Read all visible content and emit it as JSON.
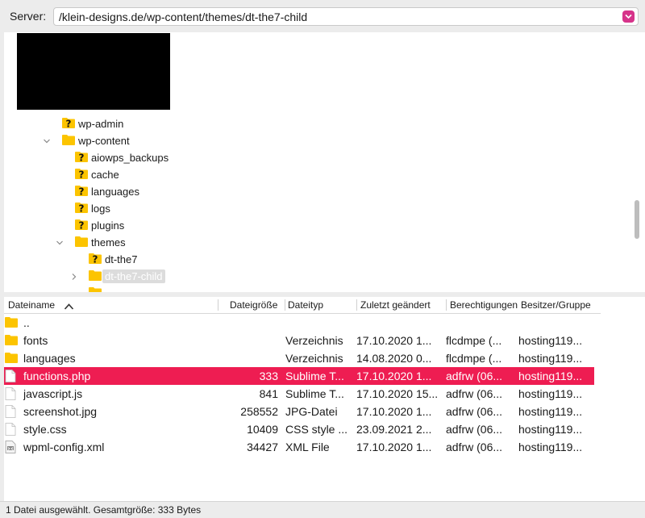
{
  "server": {
    "label": "Server:",
    "path": "/klein-designs.de/wp-content/themes/dt-the7-child"
  },
  "tree": {
    "nodes": [
      {
        "label": "wp-admin",
        "icon": "question-folder-icon",
        "expanded": false
      },
      {
        "label": "wp-content",
        "icon": "folder-icon",
        "expanded": true
      },
      {
        "label": "aiowps_backups",
        "icon": "question-folder-icon",
        "expanded": false
      },
      {
        "label": "cache",
        "icon": "question-folder-icon",
        "expanded": false
      },
      {
        "label": "languages",
        "icon": "question-folder-icon",
        "expanded": false
      },
      {
        "label": "logs",
        "icon": "question-folder-icon",
        "expanded": false
      },
      {
        "label": "plugins",
        "icon": "question-folder-icon",
        "expanded": false
      },
      {
        "label": "themes",
        "icon": "folder-icon",
        "expanded": true
      },
      {
        "label": "dt-the7",
        "icon": "question-folder-icon",
        "expanded": false
      },
      {
        "label": "dt-the7-child",
        "icon": "folder-icon",
        "expanded": false,
        "selected": true
      }
    ]
  },
  "list": {
    "columns": {
      "name": "Dateiname",
      "size": "Dateigröße",
      "type": "Dateityp",
      "modified": "Zuletzt geändert",
      "perms": "Berechtigungen",
      "owner": "Besitzer/Gruppe"
    },
    "rows": [
      {
        "name": "..",
        "size": "",
        "type": "",
        "modified": "",
        "perms": "",
        "owner": "",
        "icon": "folder-icon"
      },
      {
        "name": "fonts",
        "size": "",
        "type": "Verzeichnis",
        "modified": "17.10.2020 1...",
        "perms": "flcdmpe (...",
        "owner": "hosting119...",
        "icon": "folder-icon"
      },
      {
        "name": "languages",
        "size": "",
        "type": "Verzeichnis",
        "modified": "14.08.2020 0...",
        "perms": "flcdmpe (...",
        "owner": "hosting119...",
        "icon": "folder-icon"
      },
      {
        "name": "functions.php",
        "size": "333",
        "type": "Sublime T...",
        "modified": "17.10.2020 1...",
        "perms": "adfrw (06...",
        "owner": "hosting119...",
        "icon": "file-icon",
        "selected": true
      },
      {
        "name": "javascript.js",
        "size": "841",
        "type": "Sublime T...",
        "modified": "17.10.2020 15...",
        "perms": "adfrw (06...",
        "owner": "hosting119...",
        "icon": "file-icon"
      },
      {
        "name": "screenshot.jpg",
        "size": "258552",
        "type": "JPG-Datei",
        "modified": "17.10.2020 1...",
        "perms": "adfrw (06...",
        "owner": "hosting119...",
        "icon": "file-icon"
      },
      {
        "name": "style.css",
        "size": "10409",
        "type": "CSS style ...",
        "modified": "23.09.2021 2...",
        "perms": "adfrw (06...",
        "owner": "hosting119...",
        "icon": "file-icon"
      },
      {
        "name": "wpml-config.xml",
        "size": "34427",
        "type": "XML File",
        "modified": "17.10.2020 1...",
        "perms": "adfrw (06...",
        "owner": "hosting119...",
        "icon": "xml-file-icon"
      }
    ]
  },
  "status": {
    "text": "1 Datei ausgewählt. Gesamtgröße: 333 Bytes"
  },
  "colors": {
    "selection": "#ee1d52",
    "folder": "#fcc400",
    "dropdown": "#d6338a"
  }
}
